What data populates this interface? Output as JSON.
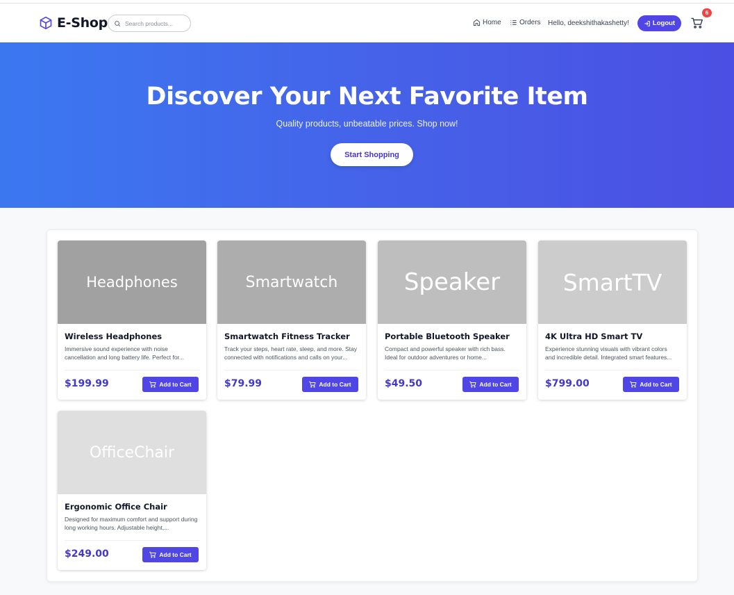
{
  "header": {
    "brand": "E-Shop",
    "search_placeholder": "Search products...",
    "home_label": "Home",
    "orders_label": "Orders",
    "greeting": "Hello, deekshithakashetty!",
    "logout_label": "Logout",
    "cart_count": "6"
  },
  "hero": {
    "title": "Discover Your Next Favorite Item",
    "subtitle": "Quality products, unbeatable prices. Shop now!",
    "cta": "Start Shopping"
  },
  "products": [
    {
      "image_text": "Headphones",
      "image_color": "#a1a1a1",
      "title": "Wireless Headphones",
      "description": "Immersive sound experience with noise cancellation and long battery life. Perfect for...",
      "price": "$199.99",
      "button": "Add to Cart"
    },
    {
      "image_text": "Smartwatch",
      "image_color": "#adadad",
      "title": "Smartwatch Fitness Tracker",
      "description": "Track your steps, heart rate, sleep, and more. Stay connected with notifications and calls on your...",
      "price": "$79.99",
      "button": "Add to Cart"
    },
    {
      "image_text": "Speaker",
      "image_color": "#bebebe",
      "title": "Portable Bluetooth Speaker",
      "description": "Compact and powerful speaker with rich bass. Ideal for outdoor adventures or home...",
      "price": "$49.50",
      "button": "Add to Cart"
    },
    {
      "image_text": "SmartTV",
      "image_color": "#cccccc",
      "title": "4K Ultra HD Smart TV",
      "description": "Experience stunning visuals with vibrant colors and incredible detail. Integrated smart features...",
      "price": "$799.00",
      "button": "Add to Cart"
    },
    {
      "image_text": "OfficeChair",
      "image_color": "#dfdfdf",
      "title": "Ergonomic Office Chair",
      "description": "Designed for maximum comfort and support during long working hours. Adjustable height,...",
      "price": "$249.00",
      "button": "Add to Cart"
    }
  ],
  "colors": {
    "accent": "#4f46e5",
    "price": "#4338ca",
    "badge": "#ef4444"
  }
}
